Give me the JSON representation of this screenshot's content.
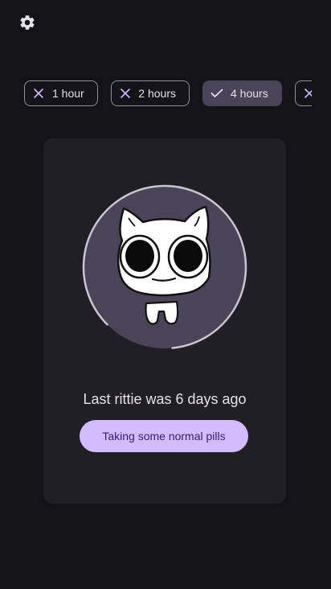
{
  "settings": {
    "icon": "gear-icon"
  },
  "chips": [
    {
      "label": "1 hour",
      "selected": false,
      "icon": "close-icon"
    },
    {
      "label": "2 hours",
      "selected": false,
      "icon": "close-icon"
    },
    {
      "label": "4 hours",
      "selected": true,
      "icon": "check-icon"
    },
    {
      "label": "",
      "selected": false,
      "icon": "close-icon"
    }
  ],
  "card": {
    "progress_fraction": 0.86,
    "status_text": "Last rittie was 6 days ago",
    "action_label": "Taking some normal pills"
  },
  "colors": {
    "background": "#141318",
    "card": "#211f26",
    "accent": "#d0bcff",
    "on_accent": "#381e72",
    "chip_selected": "#4a4458",
    "avatar_fill": "#4a4458",
    "progress_ring": "#cac4d0"
  }
}
